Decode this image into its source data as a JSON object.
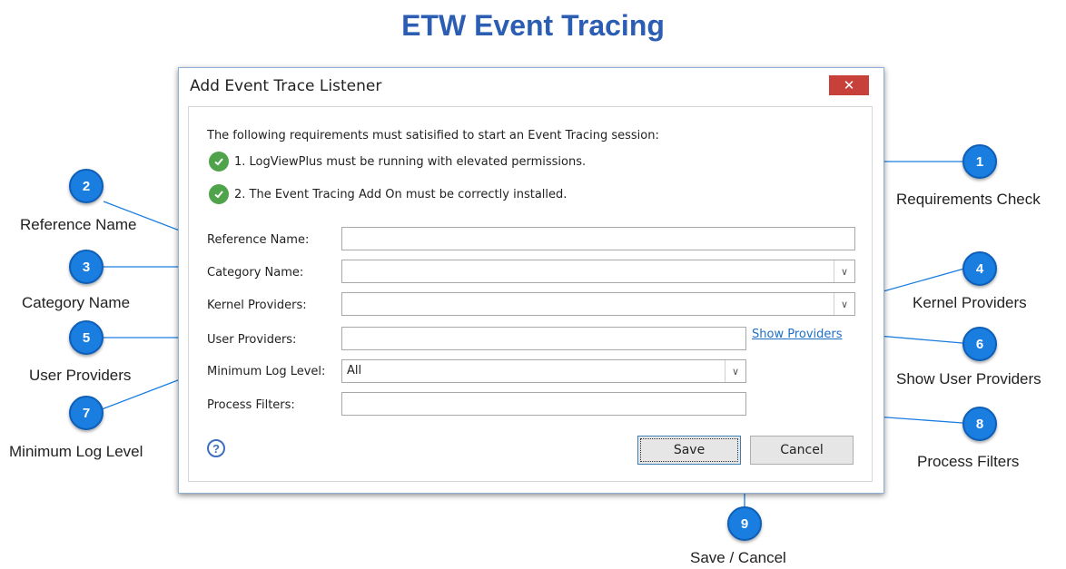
{
  "page": {
    "title": "ETW Event Tracing"
  },
  "dialog": {
    "title": "Add Event Trace Listener",
    "close_label": "✕",
    "requirements": {
      "intro": "The following requirements must satisified to start an Event Tracing session:",
      "items": [
        "1. LogViewPlus must be running with elevated permissions.",
        "2. The Event Tracing Add On must be correctly installed."
      ]
    },
    "form": {
      "reference_name": {
        "label": "Reference Name:",
        "value": ""
      },
      "category_name": {
        "label": "Category Name:",
        "value": ""
      },
      "kernel_providers": {
        "label": "Kernel Providers:",
        "value": ""
      },
      "user_providers": {
        "label": "User Providers:",
        "value": ""
      },
      "show_providers_link": "Show Providers",
      "minimum_log_level": {
        "label": "Minimum Log Level:",
        "value": "All"
      },
      "process_filters": {
        "label": "Process Filters:",
        "value": ""
      }
    },
    "buttons": {
      "save": "Save",
      "cancel": "Cancel"
    },
    "help_icon": "?"
  },
  "callouts": [
    {
      "number": "1",
      "label": "Requirements Check"
    },
    {
      "number": "2",
      "label": "Reference Name"
    },
    {
      "number": "3",
      "label": "Category Name"
    },
    {
      "number": "4",
      "label": "Kernel Providers"
    },
    {
      "number": "5",
      "label": "User Providers"
    },
    {
      "number": "6",
      "label": "Show User Providers"
    },
    {
      "number": "7",
      "label": "Minimum Log Level"
    },
    {
      "number": "8",
      "label": "Process Filters"
    },
    {
      "number": "9",
      "label": "Save / Cancel"
    }
  ],
  "colors": {
    "title": "#2b5eb3",
    "badge": "#1a7de0",
    "close_button": "#c7403a",
    "check": "#4ea34b",
    "link": "#1f6fc7"
  }
}
